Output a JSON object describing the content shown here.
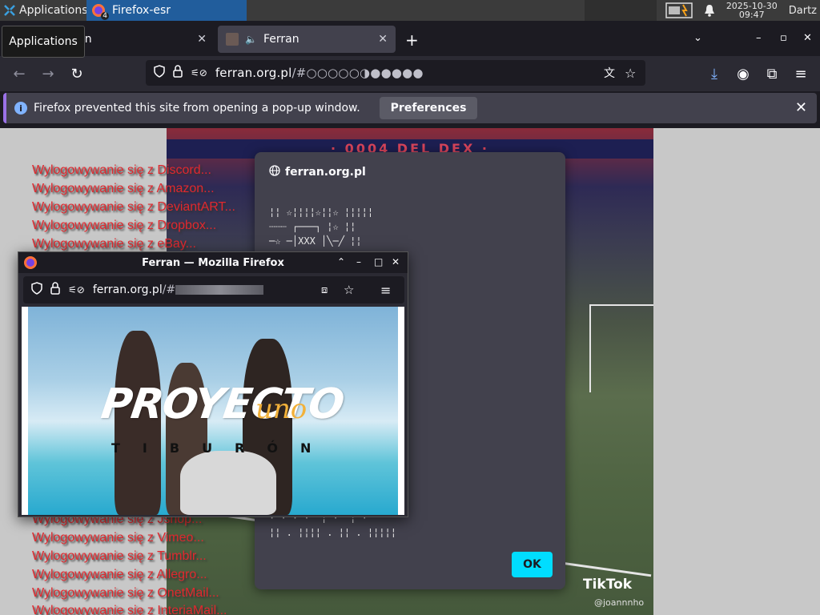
{
  "taskbar": {
    "apps_label": "Applications",
    "task_label": "Firefox-esr",
    "task_badge": "4",
    "clock_date": "2025-10-30",
    "clock_time": "09:47",
    "user": "Dartz",
    "tooltip": "Applications"
  },
  "browser": {
    "tabs": [
      {
        "label": "Ferran",
        "active": false
      },
      {
        "label": "Ferran",
        "active": true
      }
    ],
    "url_host": "ferran.org.pl",
    "url_rest": "/#○○○○○◑●●●●●",
    "notification": {
      "text": "Firefox prevented this site from opening a pop-up window.",
      "button": "Preferences"
    }
  },
  "page": {
    "red_lines_top": [
      "Wylogowywanie się z Discord...",
      "Wylogowywanie się z Amazon...",
      "Wylogowywanie się z DeviantART...",
      "Wylogowywanie się z Dropbox...",
      "Wylogowywanie się z eBay..."
    ],
    "red_lines_bottom": [
      "Wylogowywanie się z Jshop...",
      "Wylogowywanie się z Vimeo...",
      "Wylogowywanie się z Tumblr...",
      "Wylogowywanie się z Allegro...",
      "Wylogowywanie się z OnetMail...",
      "Wylogowywanie się z InteriaMail..."
    ],
    "stadium_banner": "· 0004 DEL DEX ·",
    "tiktok_label": "TikTok",
    "tiktok_user": "@joannnho"
  },
  "dialog": {
    "host": "ferran.org.pl",
    "glyphs_top": "¦¦ ☆¦¦¦¦☆¦¦☆ ¦¦¦¦¦\n┈┈┈ ┌───┐ ¦☆ ¦¦\n─☆ ─│XXX │╲─╱ ¦¦",
    "glyphs_bottom": "· · · ·  ¦ ·  ¦ ·\n¦¦ . ¦¦¦¦ . ¦¦ . ¦¦¦¦¦",
    "ok_label": "OK"
  },
  "popup": {
    "title": "Ferran — Mozilla Firefox",
    "url_host": "ferran.org.pl",
    "url_rest": "/#",
    "album_title": "PROYECTO",
    "album_accent": "uno",
    "album_line": "TIBURÓN"
  },
  "colors": {
    "accent": "#00ddff",
    "notification_border": "#9b72e8",
    "red_text": "#e0282e",
    "taskbar_active": "#215d9c"
  }
}
